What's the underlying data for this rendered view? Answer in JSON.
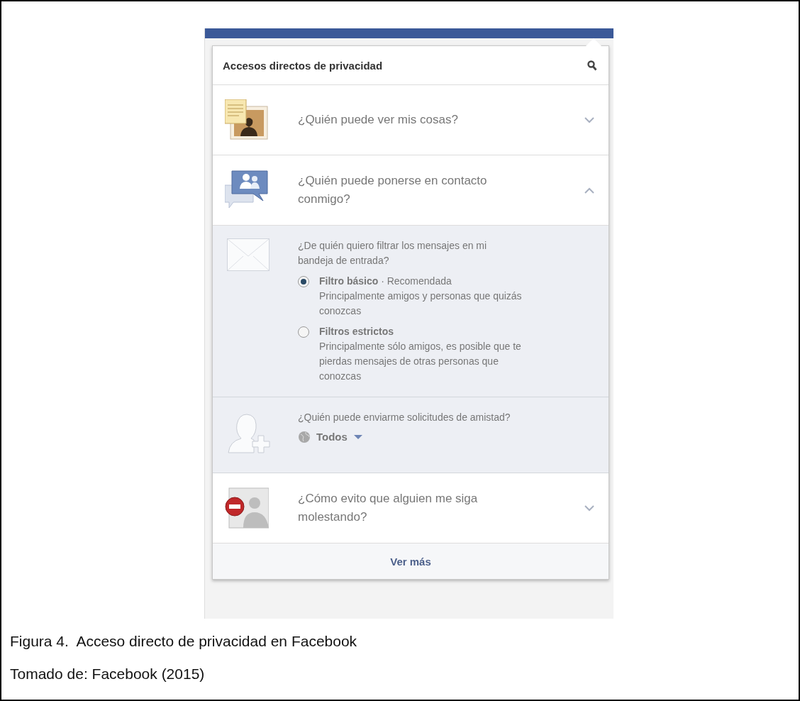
{
  "panel": {
    "title": "Accesos directos de privacidad",
    "items": [
      {
        "kind": "photos",
        "question": "¿Quién puede ver mis cosas?",
        "expanded": false
      },
      {
        "kind": "contact",
        "question": "¿Quién puede ponerse en contacto conmigo?",
        "expanded": true,
        "details": [
          {
            "kind": "radio_group",
            "question": "¿De quién quiero filtrar los mensajes en mi bandeja de entrada?",
            "options": [
              {
                "label": "Filtro básico",
                "note": "· Recomendada",
                "description": "Principalmente amigos y personas que quizás conozcas",
                "selected": true
              },
              {
                "label": "Filtros estrictos",
                "description": "Principalmente sólo amigos, es posible que te pierdas mensajes de otras personas que conozcas",
                "selected": false
              }
            ]
          },
          {
            "kind": "audience",
            "question": "¿Quién puede enviarme solicitudes de amistad?",
            "value": "Todos"
          }
        ]
      },
      {
        "kind": "block",
        "question": "¿Cómo evito que alguien me siga molestando?",
        "expanded": false
      }
    ],
    "footer": "Ver más"
  },
  "caption": [
    "Figura 4.  Acceso directo de privacidad en Facebook",
    "Tomado de: Facebook (2015)"
  ]
}
